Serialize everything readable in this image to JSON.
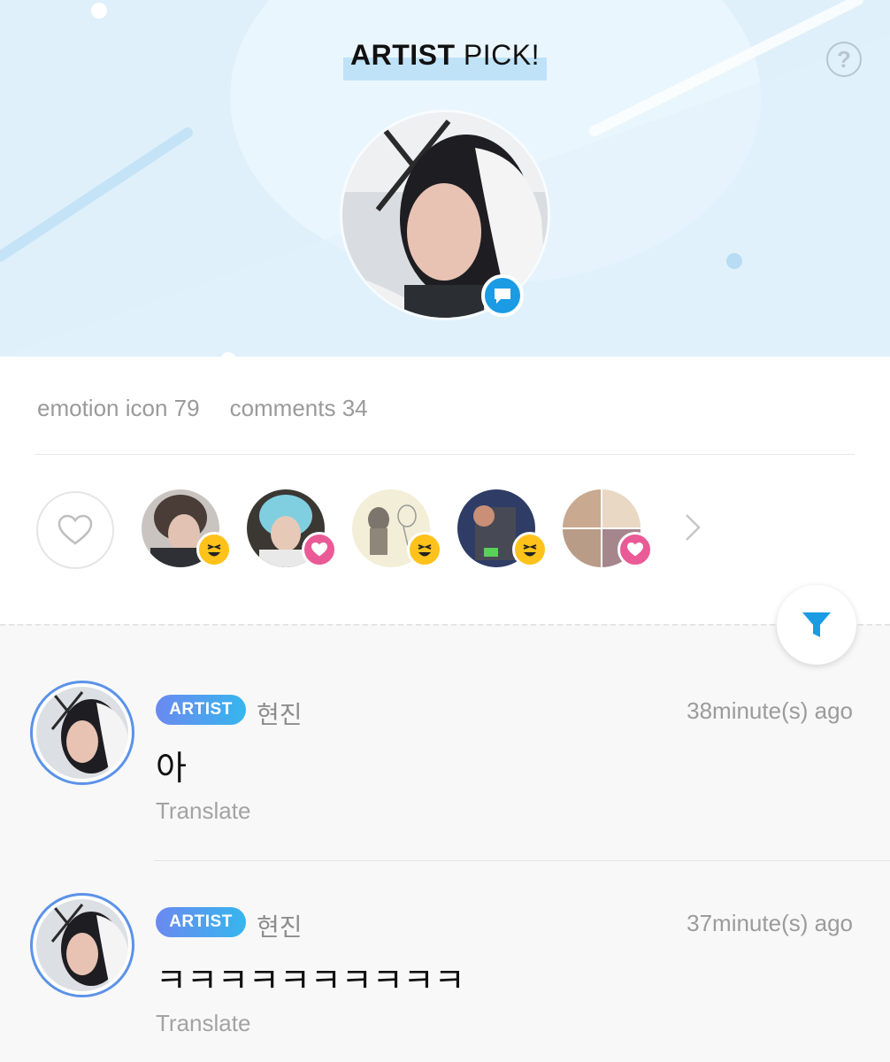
{
  "header": {
    "title_bold": "ARTIST",
    "title_rest": " PICK!",
    "help_label": "?"
  },
  "stats": {
    "emotion_label": "emotion icon 79",
    "comments_label": "comments 34"
  },
  "reactions": [
    {
      "emotion": "laugh",
      "emotion_icon": "laughing-face-icon"
    },
    {
      "emotion": "heart",
      "emotion_icon": "heart-icon"
    },
    {
      "emotion": "laugh",
      "emotion_icon": "laughing-face-icon"
    },
    {
      "emotion": "laugh",
      "emotion_icon": "laughing-face-icon"
    },
    {
      "emotion": "heart",
      "emotion_icon": "heart-icon"
    }
  ],
  "comments": [
    {
      "badge": "ARTIST",
      "name": "현진",
      "time": "38minute(s) ago",
      "text": "아",
      "translate": "Translate"
    },
    {
      "badge": "ARTIST",
      "name": "현진",
      "time": "37minute(s) ago",
      "text": "ㅋㅋㅋㅋㅋㅋㅋㅋㅋㅋ",
      "translate": "Translate"
    }
  ],
  "colors": {
    "banner_bg": "#dff0fb",
    "accent_blue": "#1a9be4",
    "laugh_yellow": "#ffc21a",
    "heart_pink": "#ea5a96",
    "badge_gradient_start": "#6b89f0",
    "badge_gradient_end": "#36b6ee"
  }
}
